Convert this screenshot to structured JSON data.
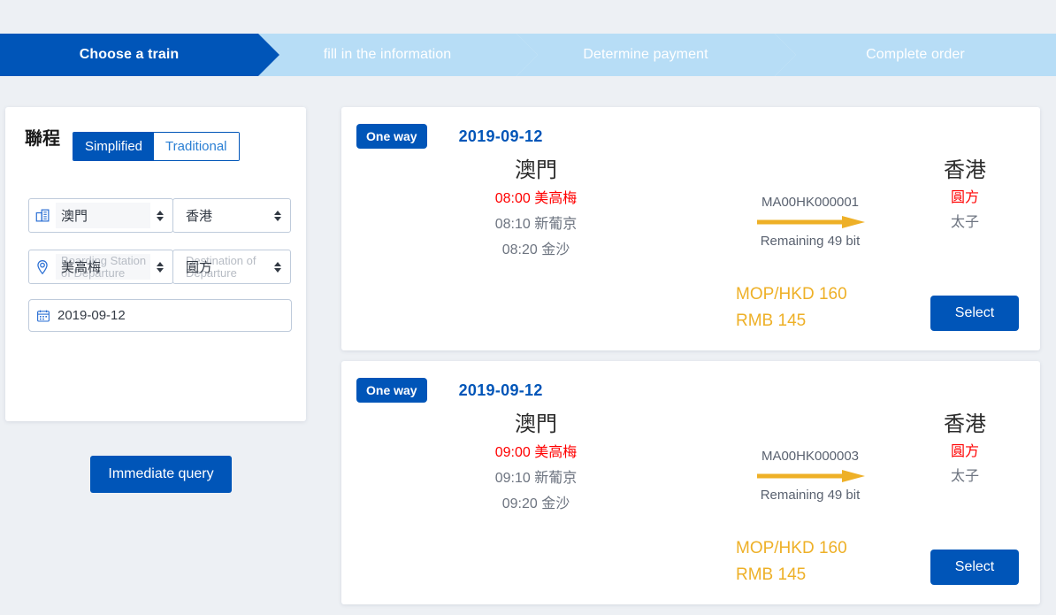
{
  "colors": {
    "brand_blue": "#0055b8",
    "step_pale": "#b7ddf6",
    "page_bg": "#edf0f4",
    "price_amber": "#eeb027",
    "highlight_red": "#ff0000",
    "arrow_amber": "#eeb027"
  },
  "steps": [
    {
      "label": "Choose a train",
      "state": "active"
    },
    {
      "label": "fill in the information",
      "state": "pending"
    },
    {
      "label": "Determine payment",
      "state": "pending"
    },
    {
      "label": "Complete order",
      "state": "pending"
    }
  ],
  "sidebar": {
    "title": "聯程",
    "toggle": {
      "simplified": "Simplified",
      "traditional": "Traditional"
    },
    "region_from": {
      "icon": "building-icon",
      "value": "澳門"
    },
    "region_to": {
      "value": "香港"
    },
    "station_from": {
      "icon": "location-pin-icon",
      "value": "美高梅",
      "placeholder": "Boarding Station of Departure"
    },
    "station_to": {
      "value": "圓方",
      "placeholder": "Destination of Departure"
    },
    "date": {
      "icon": "calendar-icon",
      "value": "2019-09-12"
    },
    "query_button": "Immediate query"
  },
  "results": [
    {
      "badge": "One way",
      "date": "2019-09-12",
      "depart_city": "澳門",
      "depart_stops": [
        {
          "time": "08:00",
          "name": "美高梅",
          "highlight": true
        },
        {
          "time": "08:10",
          "name": "新葡京",
          "highlight": false
        },
        {
          "time": "08:20",
          "name": "金沙",
          "highlight": false
        }
      ],
      "train_no": "MA00HK000001",
      "remaining": "Remaining 49 bit",
      "arrive_city": "香港",
      "arrive_stops": [
        {
          "name": "圓方",
          "highlight": true
        },
        {
          "name": "太子",
          "highlight": false
        }
      ],
      "price_primary": "MOP/HKD 160",
      "price_secondary": "RMB 145",
      "select_button": "Select"
    },
    {
      "badge": "One way",
      "date": "2019-09-12",
      "depart_city": "澳門",
      "depart_stops": [
        {
          "time": "09:00",
          "name": "美高梅",
          "highlight": true
        },
        {
          "time": "09:10",
          "name": "新葡京",
          "highlight": false
        },
        {
          "time": "09:20",
          "name": "金沙",
          "highlight": false
        }
      ],
      "train_no": "MA00HK000003",
      "remaining": "Remaining 49 bit",
      "arrive_city": "香港",
      "arrive_stops": [
        {
          "name": "圓方",
          "highlight": true
        },
        {
          "name": "太子",
          "highlight": false
        }
      ],
      "price_primary": "MOP/HKD 160",
      "price_secondary": "RMB 145",
      "select_button": "Select"
    }
  ]
}
